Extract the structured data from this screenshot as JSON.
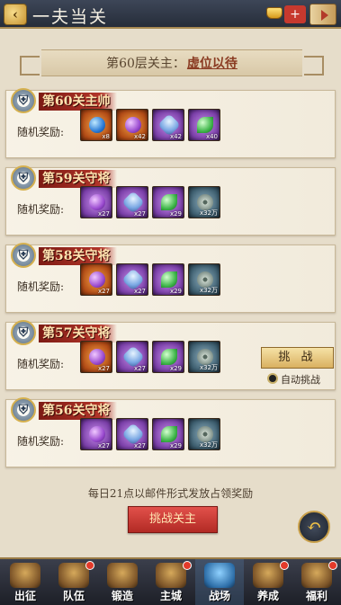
{
  "header": {
    "title": "一夫当关"
  },
  "banner": {
    "prefix": "第60层关主：",
    "boss_name": "虚位以待"
  },
  "reward_label": "随机奖励:",
  "stages": [
    {
      "title": "第60关主帅",
      "rewards": [
        {
          "bg": "orange",
          "gem": "blue",
          "qty": "x8"
        },
        {
          "bg": "orange",
          "gem": "purple",
          "qty": "x42"
        },
        {
          "bg": "purple",
          "gem": "crystal",
          "qty": "x42"
        },
        {
          "bg": "purple",
          "gem": "green",
          "qty": "x40"
        }
      ]
    },
    {
      "title": "第59关守将",
      "rewards": [
        {
          "bg": "purple",
          "gem": "purple",
          "qty": "x27"
        },
        {
          "bg": "purple",
          "gem": "crystal",
          "qty": "x27"
        },
        {
          "bg": "purple",
          "gem": "green",
          "qty": "x29"
        },
        {
          "bg": "green",
          "gem": "coin",
          "qty": "x32万"
        }
      ]
    },
    {
      "title": "第58关守将",
      "rewards": [
        {
          "bg": "orange",
          "gem": "purple",
          "qty": "x27"
        },
        {
          "bg": "purple",
          "gem": "crystal",
          "qty": "x27"
        },
        {
          "bg": "purple",
          "gem": "green",
          "qty": "x29"
        },
        {
          "bg": "green",
          "gem": "coin",
          "qty": "x32万"
        }
      ]
    },
    {
      "title": "第57关守将",
      "rewards": [
        {
          "bg": "orange",
          "gem": "purple",
          "qty": "x27"
        },
        {
          "bg": "purple",
          "gem": "crystal",
          "qty": "x27"
        },
        {
          "bg": "purple",
          "gem": "green",
          "qty": "x29"
        },
        {
          "bg": "green",
          "gem": "coin",
          "qty": "x32万"
        }
      ]
    },
    {
      "title": "第56关守将",
      "rewards": [
        {
          "bg": "purple",
          "gem": "purple",
          "qty": "x27"
        },
        {
          "bg": "purple",
          "gem": "crystal",
          "qty": "x27"
        },
        {
          "bg": "purple",
          "gem": "green",
          "qty": "x29"
        },
        {
          "bg": "green",
          "gem": "coin",
          "qty": "x32万"
        }
      ]
    }
  ],
  "challenge": {
    "label": "挑 战",
    "auto_label": "自动挑战"
  },
  "footer": {
    "mail_note": "每日21点以邮件形式发放占领奖励",
    "boss_button": "挑战关主"
  },
  "nav": [
    {
      "label": "出征",
      "dot": false,
      "active": false
    },
    {
      "label": "队伍",
      "dot": true,
      "active": false
    },
    {
      "label": "锻造",
      "dot": false,
      "active": false
    },
    {
      "label": "主城",
      "dot": true,
      "active": false
    },
    {
      "label": "战场",
      "dot": false,
      "active": true
    },
    {
      "label": "养成",
      "dot": true,
      "active": false
    },
    {
      "label": "福利",
      "dot": true,
      "active": false
    }
  ],
  "colors": {
    "accent_red": "#b3352a",
    "gold": "#d9b060",
    "nav_bg": "#2b2f3a"
  }
}
